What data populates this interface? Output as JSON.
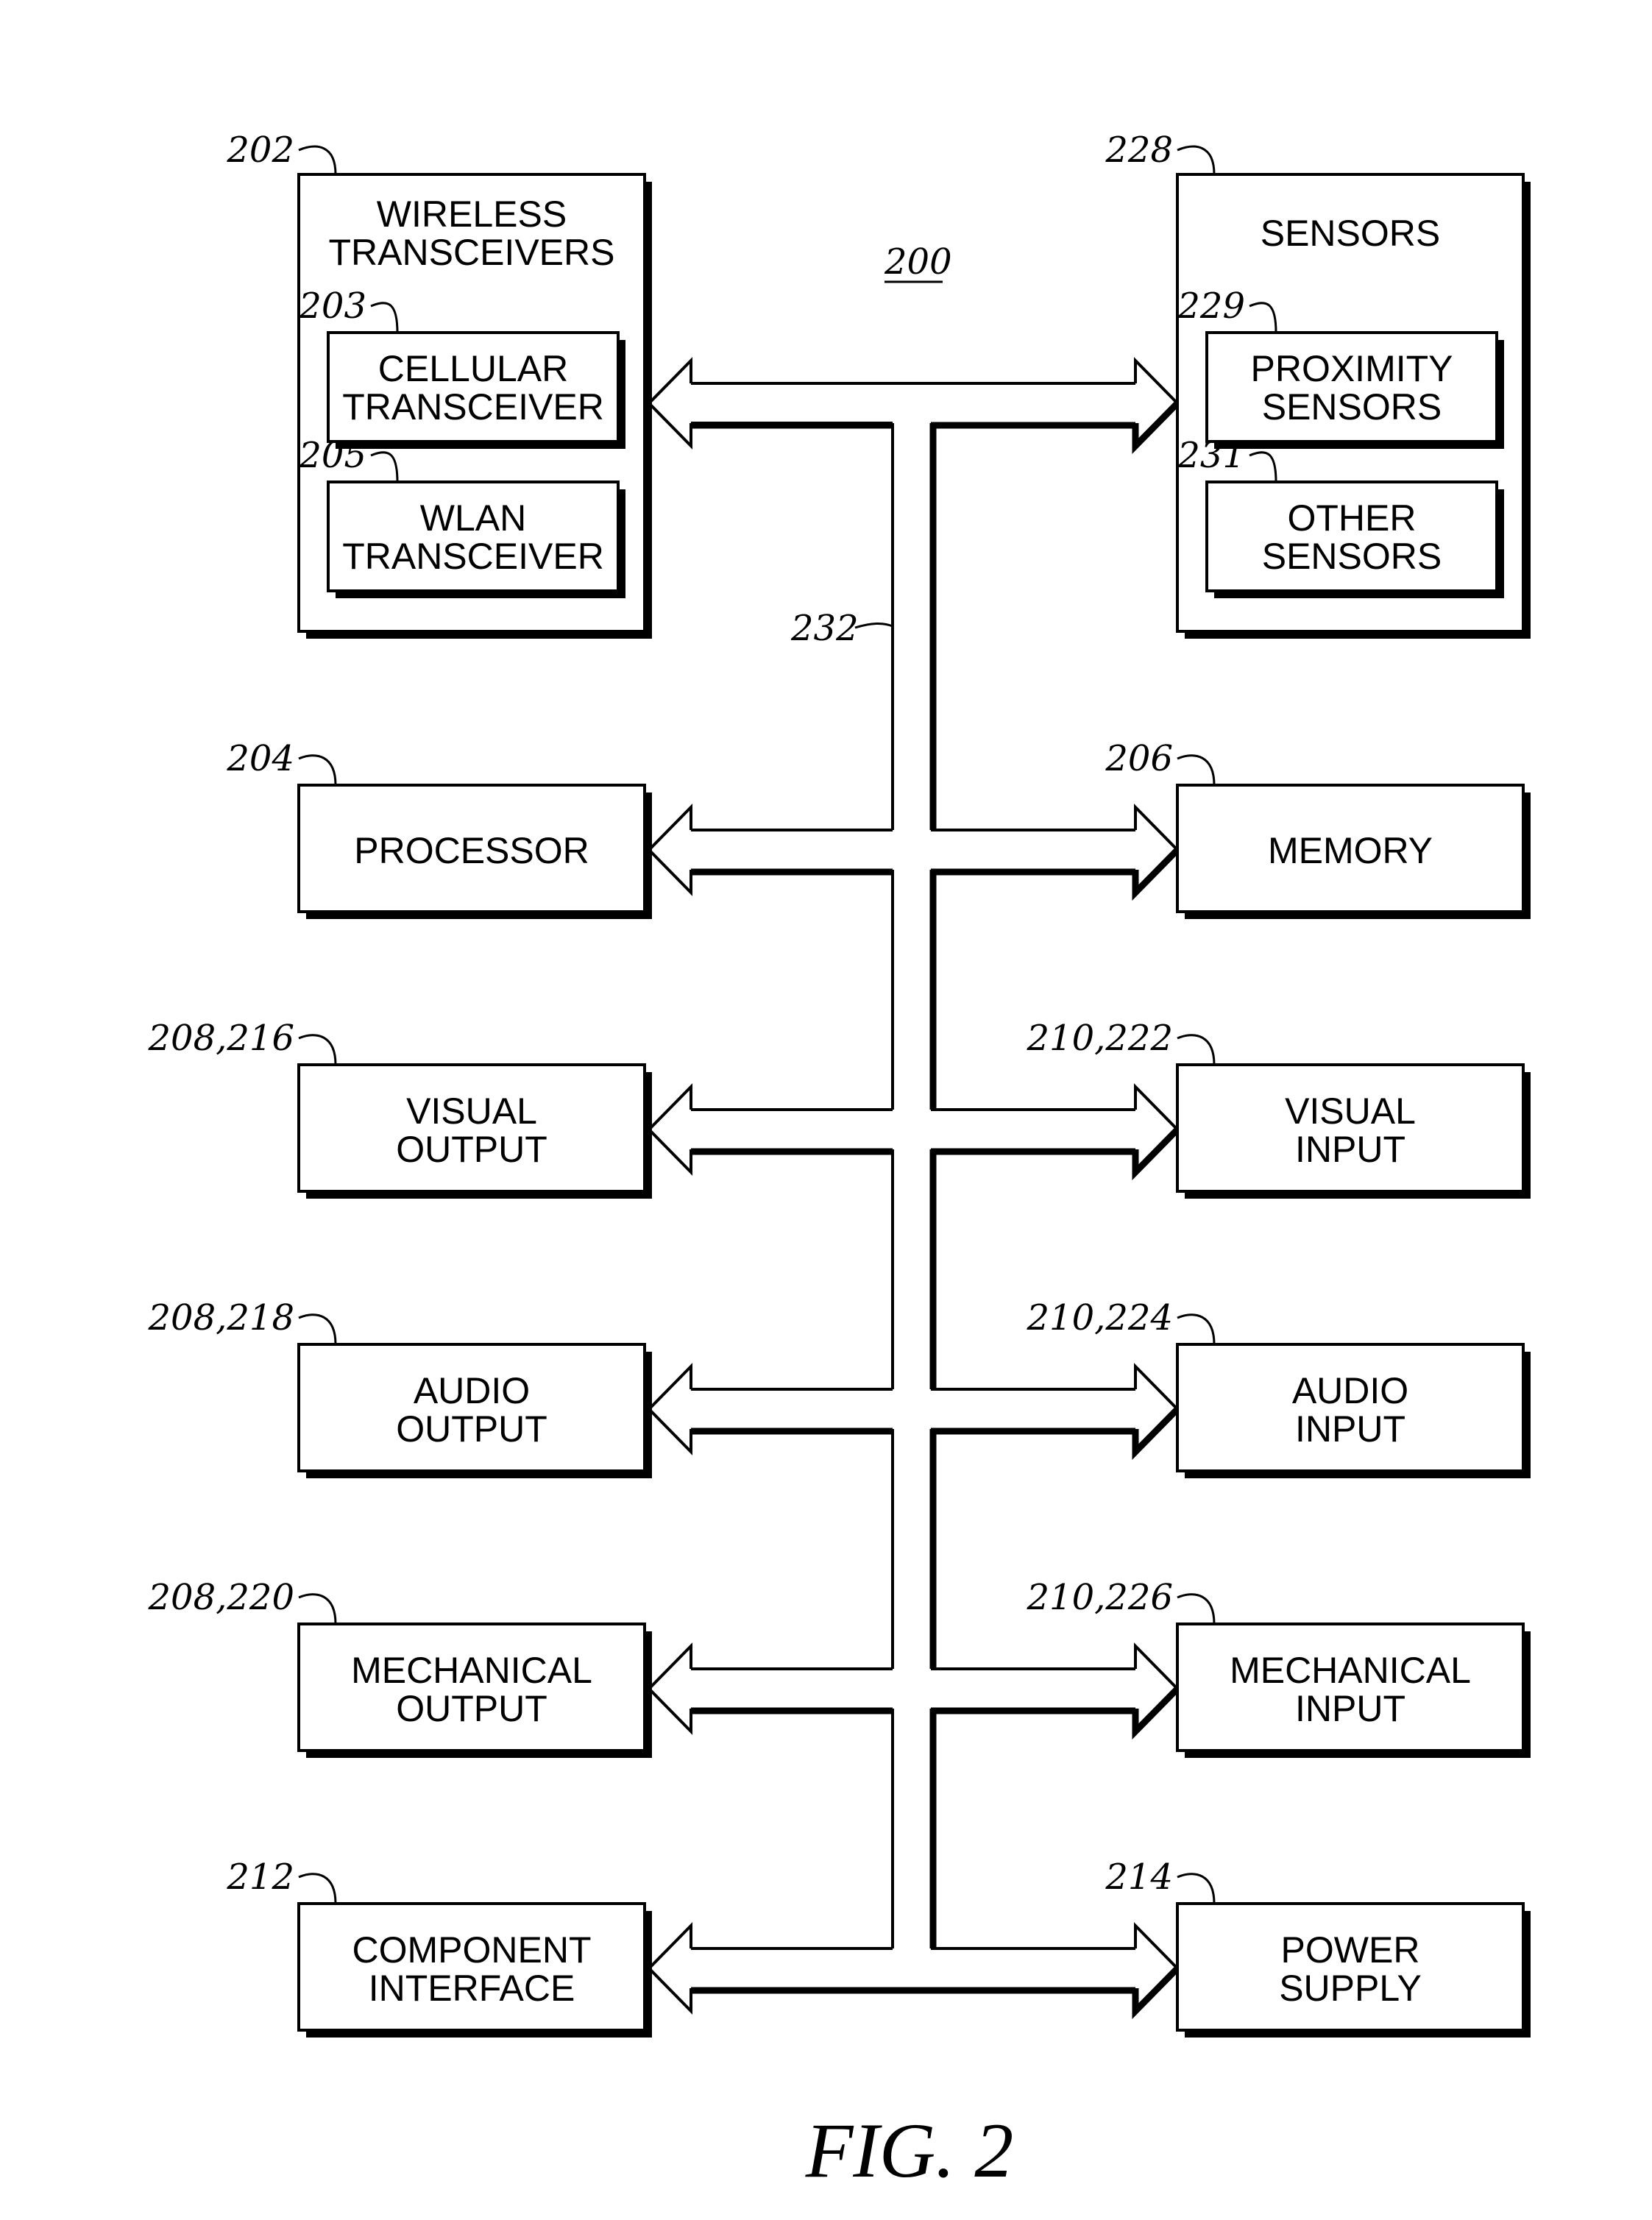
{
  "figure": {
    "caption": "FIG. 2",
    "reference": "200",
    "bus_reference": "232"
  },
  "colors": {
    "ink": "#000000",
    "paper": "#ffffff"
  },
  "top_row": {
    "left": {
      "ref": "202",
      "title_lines": [
        "WIRELESS",
        "TRANSCEIVERS"
      ],
      "children": [
        {
          "ref": "203",
          "lines": [
            "CELLULAR",
            "TRANSCEIVER"
          ]
        },
        {
          "ref": "205",
          "lines": [
            "WLAN",
            "TRANSCEIVER"
          ]
        }
      ]
    },
    "right": {
      "ref": "228",
      "title_lines": [
        "SENSORS"
      ],
      "children": [
        {
          "ref": "229",
          "lines": [
            "PROXIMITY",
            "SENSORS"
          ]
        },
        {
          "ref": "231",
          "lines": [
            "OTHER",
            "SENSORS"
          ]
        }
      ]
    }
  },
  "rows": [
    {
      "left": {
        "ref": "204",
        "lines": [
          "PROCESSOR"
        ]
      },
      "right": {
        "ref": "206",
        "lines": [
          "MEMORY"
        ]
      }
    },
    {
      "left": {
        "ref": "208,216",
        "lines": [
          "VISUAL",
          "OUTPUT"
        ]
      },
      "right": {
        "ref": "210,222",
        "lines": [
          "VISUAL",
          "INPUT"
        ]
      }
    },
    {
      "left": {
        "ref": "208,218",
        "lines": [
          "AUDIO",
          "OUTPUT"
        ]
      },
      "right": {
        "ref": "210,224",
        "lines": [
          "AUDIO",
          "INPUT"
        ]
      }
    },
    {
      "left": {
        "ref": "208,220",
        "lines": [
          "MECHANICAL",
          "OUTPUT"
        ]
      },
      "right": {
        "ref": "210,226",
        "lines": [
          "MECHANICAL",
          "INPUT"
        ]
      }
    },
    {
      "left": {
        "ref": "212",
        "lines": [
          "COMPONENT",
          "INTERFACE"
        ]
      },
      "right": {
        "ref": "214",
        "lines": [
          "POWER",
          "SUPPLY"
        ]
      }
    }
  ]
}
